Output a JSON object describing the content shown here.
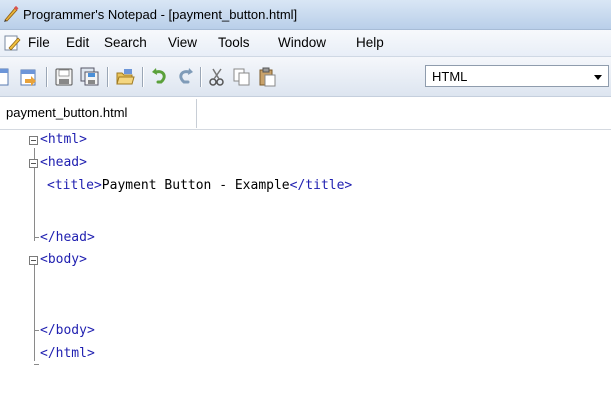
{
  "window": {
    "title": "Programmer's Notepad - [payment_button.html]"
  },
  "menu": [
    "File",
    "Edit",
    "Search",
    "View",
    "Tools",
    "Window",
    "Help"
  ],
  "toolbar": {
    "language": "HTML"
  },
  "tabs": [
    {
      "label": "payment_button.html"
    }
  ],
  "editor": {
    "lines": [
      {
        "open": "<html>",
        "text": "",
        "close": ""
      },
      {
        "open": "<head>",
        "text": "",
        "close": ""
      },
      {
        "open": "<title>",
        "text": "Payment Button - Example",
        "close": "</title>"
      },
      {
        "open": "</head>",
        "text": "",
        "close": ""
      },
      {
        "open": "<body>",
        "text": "",
        "close": ""
      },
      {
        "open": "",
        "text": "",
        "close": ""
      },
      {
        "open": "",
        "text": "",
        "close": ""
      },
      {
        "open": "</body>",
        "text": "",
        "close": ""
      },
      {
        "open": "</html>",
        "text": "",
        "close": ""
      }
    ]
  }
}
